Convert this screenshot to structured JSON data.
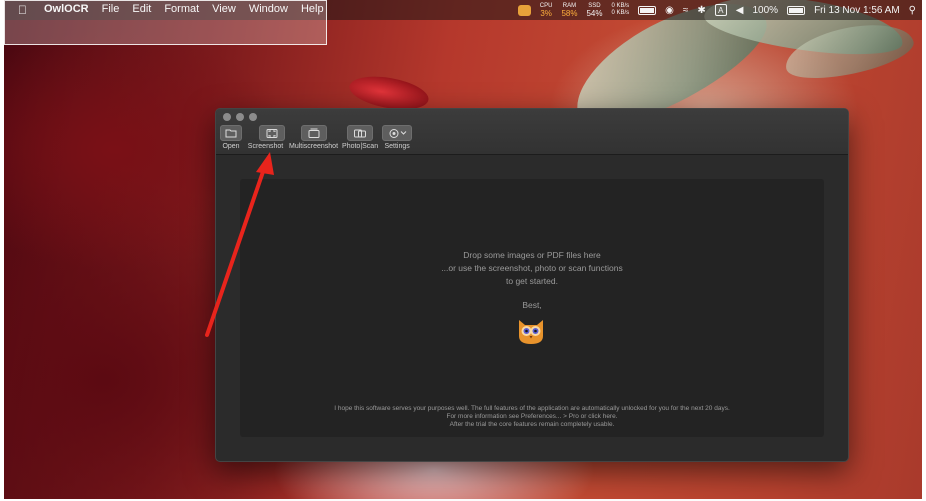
{
  "menubar": {
    "app_name": "OwlOCR",
    "items": [
      "File",
      "Edit",
      "Format",
      "View",
      "Window",
      "Help"
    ],
    "status": {
      "cpu_label": "CPU",
      "cpu_value": "3%",
      "ram_label": "RAM",
      "ram_value": "58%",
      "ssd_label": "SSD",
      "ssd_value": "54%",
      "net_up": "0 KB/s",
      "net_down": "0 KB/s",
      "input_source": "A",
      "battery": "100%",
      "clock": "Fri 13 Nov  1:56 AM"
    }
  },
  "toolbar": {
    "open_label": "Open",
    "screenshot_label": "Screenshot",
    "multiscreenshot_label": "Multiscreenshot",
    "photoscan_label": "Photo|Scan",
    "settings_label": "Settings"
  },
  "drop_area": {
    "line1": "Drop some images or PDF files here",
    "line2": "...or use the screenshot, photo or scan functions",
    "line3": "to get started.",
    "signoff": "Best,",
    "footnote1": "I hope this software serves your purposes well. The full features of the application are automatically unlocked for you for the next 20 days.",
    "footnote2": "For more information see Preferences... > Pro or click here.",
    "footnote3": "After the trial the core features remain completely usable."
  },
  "colors": {
    "annotation_arrow": "#e8241c",
    "window_bg": "#2b2b2b",
    "drop_area_bg": "#232323",
    "owl": "#e8932c"
  },
  "icons": {
    "apple": "apple-logo-icon",
    "open": "folder-icon",
    "screenshot": "screenshot-icon",
    "multiscreenshot": "multiscreenshot-icon",
    "photoscan": "photo-scan-icon",
    "settings": "gear-icon"
  }
}
